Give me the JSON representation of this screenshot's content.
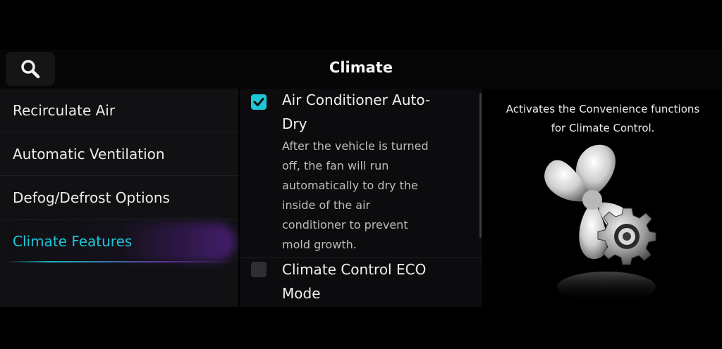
{
  "header": {
    "title": "Climate",
    "search_icon": "search-icon"
  },
  "sidebar": {
    "items": [
      {
        "label": "Recirculate Air",
        "active": false
      },
      {
        "label": "Automatic Ventilation",
        "active": false
      },
      {
        "label": "Defog/Defrost Options",
        "active": false
      },
      {
        "label": "Climate Features",
        "active": true
      }
    ]
  },
  "settings": {
    "items": [
      {
        "title_line1": "Air Conditioner Auto-",
        "title_line2": "Dry",
        "checked": true,
        "description_lines": [
          "After the vehicle is turned",
          "off, the fan will run",
          "automatically to dry the",
          "inside of the air",
          "conditioner to prevent",
          "mold growth."
        ]
      },
      {
        "title_line1": "Climate Control ECO",
        "title_line2": "Mode",
        "checked": false
      }
    ]
  },
  "info_panel": {
    "line1": "Activates the Convenience functions",
    "line2": "for Climate Control.",
    "illustration_icon": "fan-gear-icon"
  },
  "colors": {
    "accent": "#1ec7d6",
    "active_glow": "#6e28b4"
  }
}
